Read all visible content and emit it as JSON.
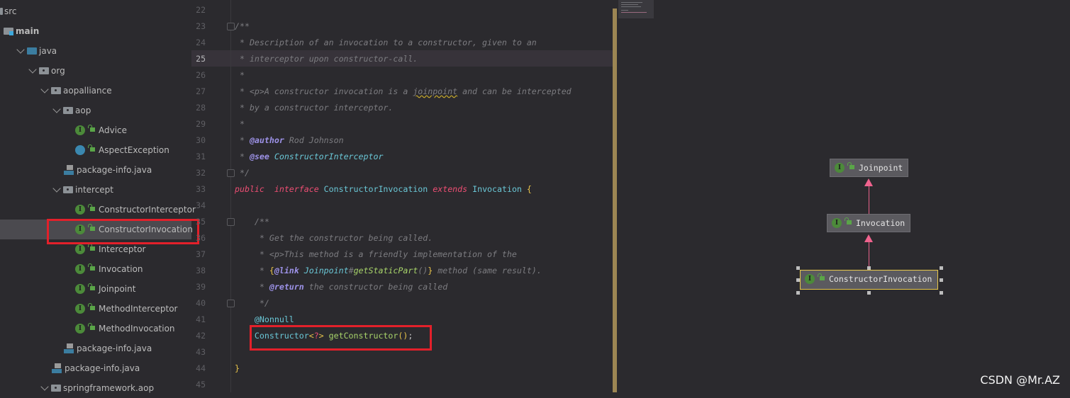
{
  "project_tree": {
    "selected": "ConstructorInvocation",
    "items": [
      {
        "label": "src",
        "depth": 0,
        "icon": "src-folder-icon",
        "expanded": null
      },
      {
        "label": "main",
        "depth": 0,
        "icon": "module-folder-icon",
        "bold": true,
        "expanded": null
      },
      {
        "label": "java",
        "depth": 1,
        "icon": "source-root-folder-icon",
        "expanded": true
      },
      {
        "label": "org",
        "depth": 2,
        "icon": "package-icon",
        "expanded": true
      },
      {
        "label": "aopalliance",
        "depth": 3,
        "icon": "package-icon",
        "expanded": true
      },
      {
        "label": "aop",
        "depth": 4,
        "icon": "package-icon",
        "expanded": true
      },
      {
        "label": "Advice",
        "depth": 5,
        "icon": "interface-icon"
      },
      {
        "label": "AspectException",
        "depth": 5,
        "icon": "exception-icon"
      },
      {
        "label": "package-info.java",
        "depth": 5,
        "icon": "java-file-icon"
      },
      {
        "label": "intercept",
        "depth": 4,
        "icon": "package-icon",
        "expanded": true
      },
      {
        "label": "ConstructorInterceptor",
        "depth": 5,
        "icon": "interface-icon"
      },
      {
        "label": "ConstructorInvocation",
        "depth": 5,
        "icon": "interface-icon",
        "selected": true
      },
      {
        "label": "Interceptor",
        "depth": 5,
        "icon": "interface-icon"
      },
      {
        "label": "Invocation",
        "depth": 5,
        "icon": "interface-icon"
      },
      {
        "label": "Joinpoint",
        "depth": 5,
        "icon": "interface-icon"
      },
      {
        "label": "MethodInterceptor",
        "depth": 5,
        "icon": "interface-icon"
      },
      {
        "label": "MethodInvocation",
        "depth": 5,
        "icon": "interface-icon"
      },
      {
        "label": "package-info.java",
        "depth": 5,
        "icon": "java-file-icon"
      },
      {
        "label": "package-info.java",
        "depth": 4,
        "icon": "java-file-icon"
      },
      {
        "label": "springframework.aop",
        "depth": 3,
        "icon": "package-icon",
        "expanded": true
      }
    ]
  },
  "editor": {
    "first_line": 22,
    "current_line": 25,
    "line_numbers": [
      "22",
      "23",
      "24",
      "25",
      "26",
      "27",
      "28",
      "29",
      "30",
      "31",
      "32",
      "33",
      "34",
      "35",
      "36",
      "37",
      "38",
      "39",
      "40",
      "41",
      "42",
      "43",
      "44",
      "45"
    ],
    "lines": [
      [],
      [
        [
          "cm",
          "/**"
        ]
      ],
      [
        [
          "cm",
          " * Description of an invocation to a constructor, given to an"
        ]
      ],
      [
        [
          "cm",
          " * interceptor upon constructor-call."
        ]
      ],
      [
        [
          "cm",
          " *"
        ]
      ],
      [
        [
          "cm",
          " * <p>A constructor invocation is a "
        ],
        [
          "cm wavy",
          "joinpoint"
        ],
        [
          "cm",
          " and can be intercepted"
        ]
      ],
      [
        [
          "cm",
          " * by a constructor interceptor."
        ]
      ],
      [
        [
          "cm",
          " *"
        ]
      ],
      [
        [
          "cm",
          " * "
        ],
        [
          "tag",
          "@author"
        ],
        [
          "cm",
          " Rod Johnson"
        ]
      ],
      [
        [
          "cm",
          " * "
        ],
        [
          "tag",
          "@see"
        ],
        [
          "cm",
          " "
        ],
        [
          "ref",
          "ConstructorInterceptor"
        ]
      ],
      [
        [
          "cm",
          " */"
        ]
      ],
      [
        [
          "kw",
          "public"
        ],
        [
          "",
          "  "
        ],
        [
          "kw",
          "interface"
        ],
        [
          "",
          " "
        ],
        [
          "ty",
          "ConstructorInvocation"
        ],
        [
          "",
          " "
        ],
        [
          "kw",
          "extends"
        ],
        [
          "",
          " "
        ],
        [
          "ty",
          "Invocation"
        ],
        [
          "",
          " "
        ],
        [
          "br",
          "{"
        ]
      ],
      [],
      [
        [
          "cm",
          "    /**"
        ]
      ],
      [
        [
          "cm",
          "     * Get the constructor being called."
        ]
      ],
      [
        [
          "cm",
          "     * <p>This method is a friendly implementation of the"
        ]
      ],
      [
        [
          "cm",
          "     * "
        ],
        [
          "br",
          "{"
        ],
        [
          "tag",
          "@link"
        ],
        [
          "cm",
          " "
        ],
        [
          "ref",
          "Joinpoint"
        ],
        [
          "cm",
          "#"
        ],
        [
          "fnr",
          "getStaticPart"
        ],
        [
          "cm",
          "()"
        ],
        [
          "br",
          "}"
        ],
        [
          "cm",
          " method (same result)."
        ]
      ],
      [
        [
          "cm",
          "     * "
        ],
        [
          "tag",
          "@return"
        ],
        [
          "cm",
          " the constructor being called"
        ]
      ],
      [
        [
          "cm",
          "     */"
        ]
      ],
      [
        [
          "an",
          "    @Nonnull"
        ]
      ],
      [
        [
          "",
          "    "
        ],
        [
          "ty",
          "Constructor"
        ],
        [
          "br",
          "<"
        ],
        [
          "q",
          "?"
        ],
        [
          "br",
          ">"
        ],
        [
          "",
          " "
        ],
        [
          "fn",
          "getConstructor"
        ],
        [
          "br",
          "()"
        ],
        [
          "",
          ";"
        ]
      ],
      [],
      [
        [
          "br",
          "}"
        ]
      ],
      []
    ]
  },
  "hierarchy_diagram": {
    "nodes": [
      {
        "label": "Joinpoint",
        "icon": "interface-icon"
      },
      {
        "label": "Invocation",
        "icon": "interface-icon"
      },
      {
        "label": "ConstructorInvocation",
        "icon": "interface-icon",
        "selected": true
      }
    ],
    "edge_color": "#f0638e",
    "interface_badge": "I"
  },
  "colors": {
    "highlight_box": "#e3202a",
    "keyword": "#ee4e73",
    "type": "#6ac7d6",
    "comment": "#7c7c80"
  },
  "watermark": "CSDN @Mr.AZ"
}
